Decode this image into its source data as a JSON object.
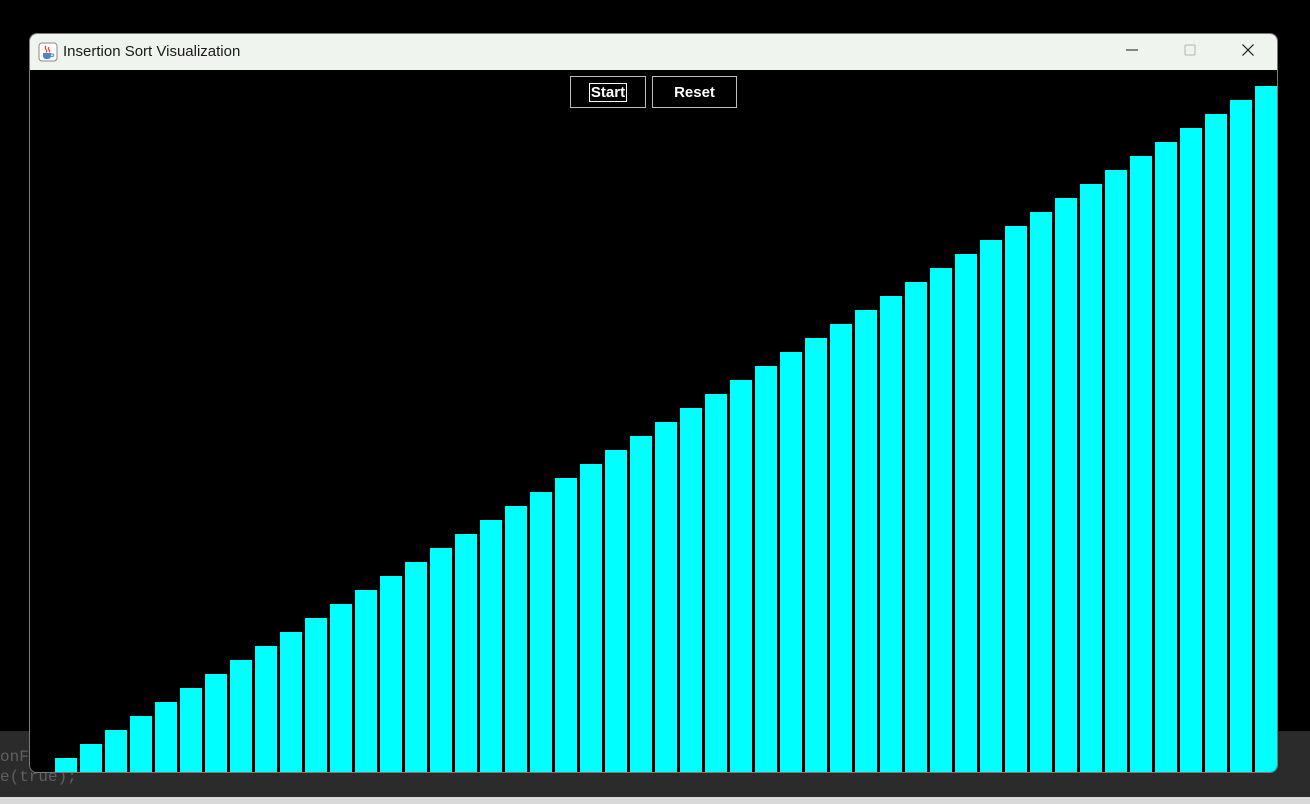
{
  "background_editor": {
    "line1": "onF",
    "line2": "e(true);"
  },
  "window": {
    "title": "Insertion Sort Visualization",
    "icon": "java-cup-icon",
    "controls": {
      "minimize_icon": "minimize-icon",
      "maximize_icon": "maximize-icon",
      "close_icon": "close-icon"
    }
  },
  "toolbar": {
    "start_label": "Start",
    "reset_label": "Reset"
  },
  "visualization": {
    "bar_color": "#00ffff",
    "background_color": "#000000",
    "bar_count": 49,
    "values": [
      1,
      2,
      3,
      4,
      5,
      6,
      7,
      8,
      9,
      10,
      11,
      12,
      13,
      14,
      15,
      16,
      17,
      18,
      19,
      20,
      21,
      22,
      23,
      24,
      25,
      26,
      27,
      28,
      29,
      30,
      31,
      32,
      33,
      34,
      35,
      36,
      37,
      38,
      39,
      40,
      41,
      42,
      43,
      44,
      45,
      46,
      47,
      48,
      49
    ],
    "sorted": true
  }
}
